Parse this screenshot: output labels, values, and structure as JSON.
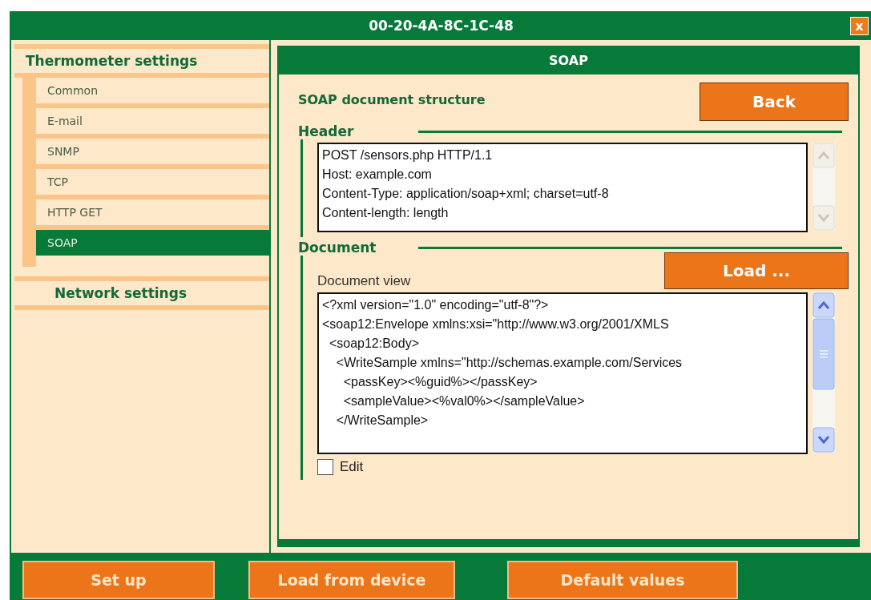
{
  "window": {
    "title": "00-20-4A-8C-1C-48",
    "close_label": "x"
  },
  "sidebar": {
    "sections": [
      {
        "label": "Thermometer settings",
        "items": [
          {
            "label": "Common",
            "selected": false
          },
          {
            "label": "E-mail",
            "selected": false
          },
          {
            "label": "SNMP",
            "selected": false
          },
          {
            "label": "TCP",
            "selected": false
          },
          {
            "label": "HTTP GET",
            "selected": false
          },
          {
            "label": "SOAP",
            "selected": true
          }
        ]
      },
      {
        "label": "Network settings"
      }
    ]
  },
  "panel": {
    "title": "SOAP",
    "heading": "SOAP document structure",
    "back_button": "Back",
    "header": {
      "label": "Header",
      "scrollbar_disabled": true,
      "lines": [
        "POST /sensors.php HTTP/1.1",
        "Host: example.com",
        "Content-Type: application/soap+xml; charset=utf-8",
        "Content-length: length"
      ]
    },
    "document": {
      "label": "Document",
      "load_button": "Load ...",
      "view_label": "Document view",
      "scrollbar_disabled": false,
      "lines": [
        "<?xml version=\"1.0\" encoding=\"utf-8\"?>",
        "<soap12:Envelope xmlns:xsi=\"http://www.w3.org/2001/XMLS",
        "  <soap12:Body>",
        "    <WriteSample xmlns=\"http://schemas.example.com/Services",
        "      <passKey><%guid%></passKey>",
        "      <sampleValue><%val0%></sampleValue>",
        "    </WriteSample>"
      ],
      "edit": {
        "label": "Edit",
        "checked": false
      }
    }
  },
  "footer_buttons": [
    "Set up",
    "Load from device",
    "Default values"
  ]
}
